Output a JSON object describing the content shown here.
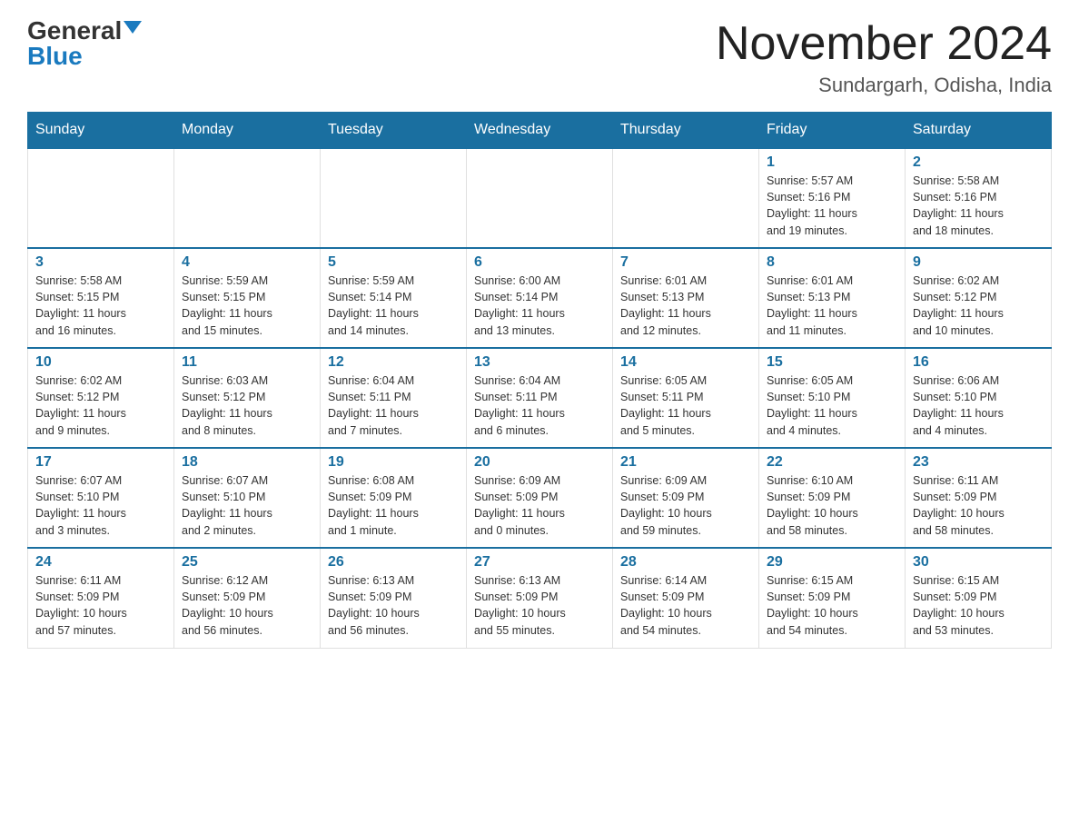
{
  "logo": {
    "general": "General",
    "blue": "Blue"
  },
  "title": "November 2024",
  "subtitle": "Sundargarh, Odisha, India",
  "weekdays": [
    "Sunday",
    "Monday",
    "Tuesday",
    "Wednesday",
    "Thursday",
    "Friday",
    "Saturday"
  ],
  "weeks": [
    [
      {
        "day": "",
        "info": ""
      },
      {
        "day": "",
        "info": ""
      },
      {
        "day": "",
        "info": ""
      },
      {
        "day": "",
        "info": ""
      },
      {
        "day": "",
        "info": ""
      },
      {
        "day": "1",
        "info": "Sunrise: 5:57 AM\nSunset: 5:16 PM\nDaylight: 11 hours\nand 19 minutes."
      },
      {
        "day": "2",
        "info": "Sunrise: 5:58 AM\nSunset: 5:16 PM\nDaylight: 11 hours\nand 18 minutes."
      }
    ],
    [
      {
        "day": "3",
        "info": "Sunrise: 5:58 AM\nSunset: 5:15 PM\nDaylight: 11 hours\nand 16 minutes."
      },
      {
        "day": "4",
        "info": "Sunrise: 5:59 AM\nSunset: 5:15 PM\nDaylight: 11 hours\nand 15 minutes."
      },
      {
        "day": "5",
        "info": "Sunrise: 5:59 AM\nSunset: 5:14 PM\nDaylight: 11 hours\nand 14 minutes."
      },
      {
        "day": "6",
        "info": "Sunrise: 6:00 AM\nSunset: 5:14 PM\nDaylight: 11 hours\nand 13 minutes."
      },
      {
        "day": "7",
        "info": "Sunrise: 6:01 AM\nSunset: 5:13 PM\nDaylight: 11 hours\nand 12 minutes."
      },
      {
        "day": "8",
        "info": "Sunrise: 6:01 AM\nSunset: 5:13 PM\nDaylight: 11 hours\nand 11 minutes."
      },
      {
        "day": "9",
        "info": "Sunrise: 6:02 AM\nSunset: 5:12 PM\nDaylight: 11 hours\nand 10 minutes."
      }
    ],
    [
      {
        "day": "10",
        "info": "Sunrise: 6:02 AM\nSunset: 5:12 PM\nDaylight: 11 hours\nand 9 minutes."
      },
      {
        "day": "11",
        "info": "Sunrise: 6:03 AM\nSunset: 5:12 PM\nDaylight: 11 hours\nand 8 minutes."
      },
      {
        "day": "12",
        "info": "Sunrise: 6:04 AM\nSunset: 5:11 PM\nDaylight: 11 hours\nand 7 minutes."
      },
      {
        "day": "13",
        "info": "Sunrise: 6:04 AM\nSunset: 5:11 PM\nDaylight: 11 hours\nand 6 minutes."
      },
      {
        "day": "14",
        "info": "Sunrise: 6:05 AM\nSunset: 5:11 PM\nDaylight: 11 hours\nand 5 minutes."
      },
      {
        "day": "15",
        "info": "Sunrise: 6:05 AM\nSunset: 5:10 PM\nDaylight: 11 hours\nand 4 minutes."
      },
      {
        "day": "16",
        "info": "Sunrise: 6:06 AM\nSunset: 5:10 PM\nDaylight: 11 hours\nand 4 minutes."
      }
    ],
    [
      {
        "day": "17",
        "info": "Sunrise: 6:07 AM\nSunset: 5:10 PM\nDaylight: 11 hours\nand 3 minutes."
      },
      {
        "day": "18",
        "info": "Sunrise: 6:07 AM\nSunset: 5:10 PM\nDaylight: 11 hours\nand 2 minutes."
      },
      {
        "day": "19",
        "info": "Sunrise: 6:08 AM\nSunset: 5:09 PM\nDaylight: 11 hours\nand 1 minute."
      },
      {
        "day": "20",
        "info": "Sunrise: 6:09 AM\nSunset: 5:09 PM\nDaylight: 11 hours\nand 0 minutes."
      },
      {
        "day": "21",
        "info": "Sunrise: 6:09 AM\nSunset: 5:09 PM\nDaylight: 10 hours\nand 59 minutes."
      },
      {
        "day": "22",
        "info": "Sunrise: 6:10 AM\nSunset: 5:09 PM\nDaylight: 10 hours\nand 58 minutes."
      },
      {
        "day": "23",
        "info": "Sunrise: 6:11 AM\nSunset: 5:09 PM\nDaylight: 10 hours\nand 58 minutes."
      }
    ],
    [
      {
        "day": "24",
        "info": "Sunrise: 6:11 AM\nSunset: 5:09 PM\nDaylight: 10 hours\nand 57 minutes."
      },
      {
        "day": "25",
        "info": "Sunrise: 6:12 AM\nSunset: 5:09 PM\nDaylight: 10 hours\nand 56 minutes."
      },
      {
        "day": "26",
        "info": "Sunrise: 6:13 AM\nSunset: 5:09 PM\nDaylight: 10 hours\nand 56 minutes."
      },
      {
        "day": "27",
        "info": "Sunrise: 6:13 AM\nSunset: 5:09 PM\nDaylight: 10 hours\nand 55 minutes."
      },
      {
        "day": "28",
        "info": "Sunrise: 6:14 AM\nSunset: 5:09 PM\nDaylight: 10 hours\nand 54 minutes."
      },
      {
        "day": "29",
        "info": "Sunrise: 6:15 AM\nSunset: 5:09 PM\nDaylight: 10 hours\nand 54 minutes."
      },
      {
        "day": "30",
        "info": "Sunrise: 6:15 AM\nSunset: 5:09 PM\nDaylight: 10 hours\nand 53 minutes."
      }
    ]
  ]
}
